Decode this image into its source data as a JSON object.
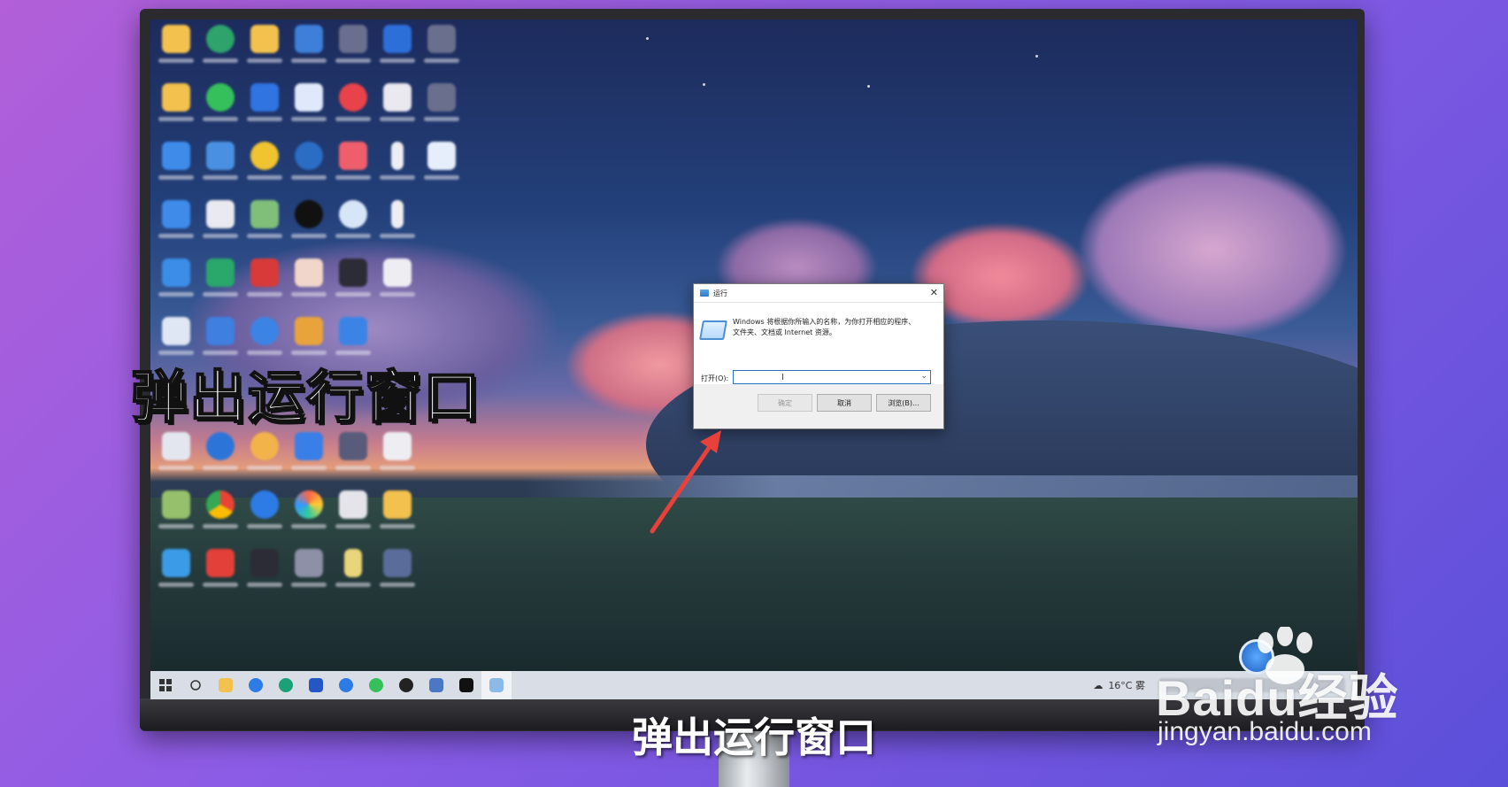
{
  "run_dialog": {
    "title": "运行",
    "description_line1": "Windows 将根据你所输入的名称，为你打开相应的程序、",
    "description_line2": "文件夹、文档或 Internet 资源。",
    "open_label": "打开(O):",
    "input_value": "",
    "ok_label": "确定",
    "cancel_label": "取消",
    "browse_label": "浏览(B)..."
  },
  "taskbar": {
    "weather": "16°C 雾"
  },
  "captions": {
    "left": "弹出运行窗口",
    "bottom": "弹出运行窗口"
  },
  "watermark": {
    "brand": "Baidu经验",
    "url": "jingyan.baidu.com"
  },
  "colors": {
    "arrow": "#e8403a",
    "accent": "#2b72c7"
  }
}
